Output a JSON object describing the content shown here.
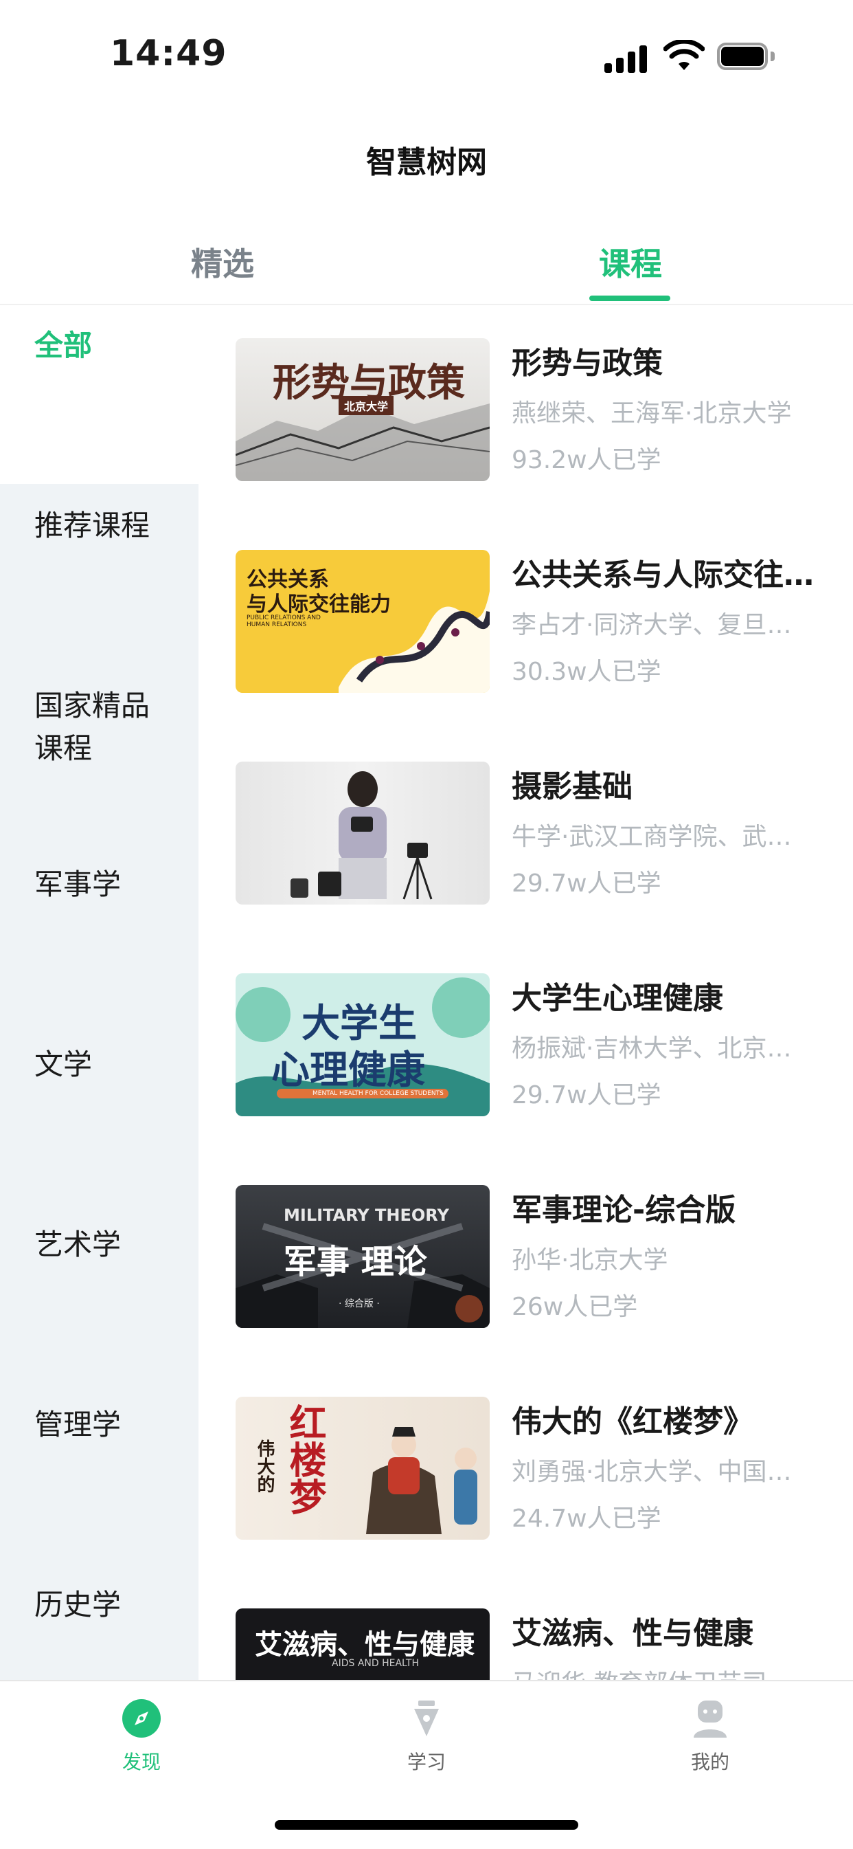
{
  "status": {
    "time": "14:49"
  },
  "header": {
    "title": "智慧树网"
  },
  "tabs": [
    {
      "label": "精选",
      "active": false
    },
    {
      "label": "课程",
      "active": true
    }
  ],
  "sidebar": {
    "items": [
      {
        "label": "全部",
        "active": true
      },
      {
        "label": "推荐课程"
      },
      {
        "label": "国家精品课程"
      },
      {
        "label": "军事学"
      },
      {
        "label": "文学"
      },
      {
        "label": "艺术学"
      },
      {
        "label": "管理学"
      },
      {
        "label": "历史学"
      }
    ]
  },
  "courses": [
    {
      "title": "形势与政策",
      "teacher": "燕继荣、王海军·北京大学",
      "count": "93.2w人已学",
      "thumb_text": "形势与政策",
      "thumb_sub": "北京大学"
    },
    {
      "title": "公共关系与人际交往能力",
      "teacher": "李占才·同济大学、复旦大学",
      "count": "30.3w人已学",
      "thumb_text": "公共关系",
      "thumb_text2": "与人际交往能力",
      "thumb_sub": "PUBLIC RELATIONS AND HUMAN RELATIONS"
    },
    {
      "title": "摄影基础",
      "teacher": "牛学·武汉工商学院、武汉大学",
      "count": "29.7w人已学"
    },
    {
      "title": "大学生心理健康",
      "teacher": "杨振斌·吉林大学、北京大学",
      "count": "29.7w人已学",
      "thumb_text": "大学生",
      "thumb_text2": "心理健康",
      "thumb_sub": "MENTAL HEALTH FOR COLLEGE STUDENTS"
    },
    {
      "title": "军事理论-综合版",
      "teacher": "孙华·北京大学",
      "count": "26w人已学",
      "thumb_text": "MILITARY THEORY",
      "thumb_text2": "军事 理论",
      "thumb_sub": "· 综合版 ·"
    },
    {
      "title": "伟大的《红楼梦》",
      "teacher": "刘勇强·北京大学、中国人民大学",
      "count": "24.7w人已学",
      "thumb_text": "红楼梦",
      "thumb_text2": "伟大的"
    },
    {
      "title": "艾滋病、性与健康",
      "teacher": "马迎华·教育部体卫艺司",
      "count": "",
      "thumb_text": "艾滋病、性与健康",
      "thumb_sub": "AIDS AND HEALTH"
    }
  ],
  "bottom_nav": [
    {
      "label": "发现",
      "icon": "compass-icon",
      "active": true
    },
    {
      "label": "学习",
      "icon": "pen-nib-icon",
      "active": false
    },
    {
      "label": "我的",
      "icon": "profile-icon",
      "active": false
    }
  ],
  "colors": {
    "accent": "#20c07a",
    "sidebar_bg": "#eff3f6",
    "muted_text": "#b3b8bd"
  }
}
